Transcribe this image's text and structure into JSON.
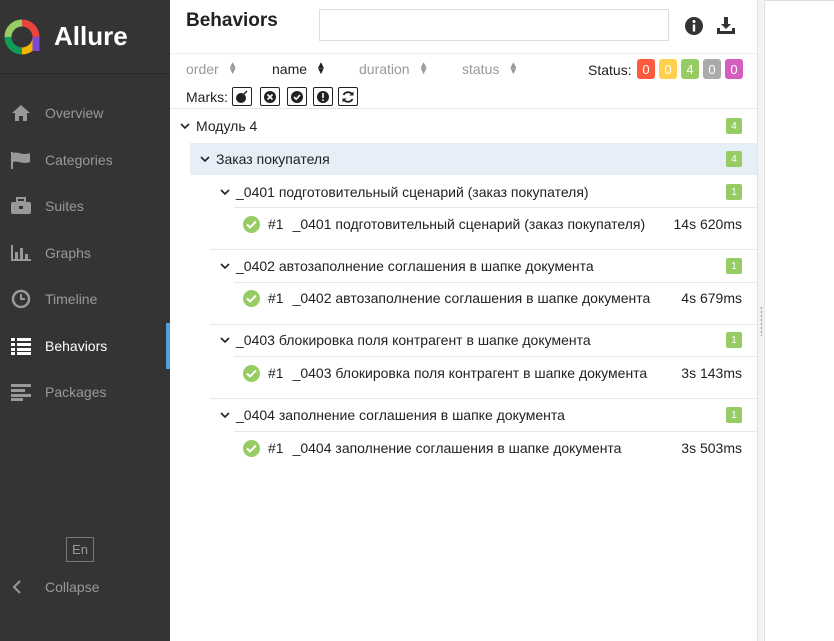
{
  "app": {
    "name": "Allure"
  },
  "sidebar": {
    "items": [
      {
        "label": "Overview",
        "icon": "home-icon"
      },
      {
        "label": "Categories",
        "icon": "flag-icon"
      },
      {
        "label": "Suites",
        "icon": "briefcase-icon"
      },
      {
        "label": "Graphs",
        "icon": "bar-chart-icon"
      },
      {
        "label": "Timeline",
        "icon": "clock-icon"
      },
      {
        "label": "Behaviors",
        "icon": "list-icon",
        "active": true
      },
      {
        "label": "Packages",
        "icon": "align-left-icon"
      }
    ],
    "language": "En",
    "collapse_label": "Collapse"
  },
  "pane": {
    "title": "Behaviors",
    "search": {
      "value": "",
      "placeholder": ""
    }
  },
  "sorting": {
    "order": "order",
    "name": "name",
    "duration": "duration",
    "status": "status"
  },
  "status_filter": {
    "label": "Status:",
    "counts": [
      "0",
      "0",
      "4",
      "0",
      "0"
    ],
    "colors": [
      "#fd5a3e",
      "#ffd050",
      "#97cc64",
      "#aaaaaa",
      "#d35ebe"
    ]
  },
  "marks": {
    "label": "Marks:"
  },
  "tree": {
    "feature": {
      "name": "Модуль 4",
      "count": "4"
    },
    "story": {
      "name": "Заказ покупателя",
      "count": "4"
    },
    "groups": [
      {
        "name": "_0401 подготовительный сценарий (заказ покупателя)",
        "count": "1",
        "case": {
          "num": "#1",
          "name": "_0401 подготовительный сценарий (заказ покупателя)",
          "duration": "14s 620ms"
        }
      },
      {
        "name": "_0402 автозаполнение соглашения в шапке документа",
        "count": "1",
        "case": {
          "num": "#1",
          "name": "_0402 автозаполнение соглашения в шапке документа",
          "duration": "4s 679ms"
        }
      },
      {
        "name": "_0403 блокировка поля контрагент в шапке документа",
        "count": "1",
        "case": {
          "num": "#1",
          "name": "_0403 блокировка поля контрагент в шапке документа",
          "duration": "3s 143ms"
        }
      },
      {
        "name": "_0404 заполнение соглашения в шапке документа",
        "count": "1",
        "case": {
          "num": "#1",
          "name": "_0404 заполнение соглашения в шапке документа",
          "duration": "3s 503ms"
        }
      }
    ]
  }
}
